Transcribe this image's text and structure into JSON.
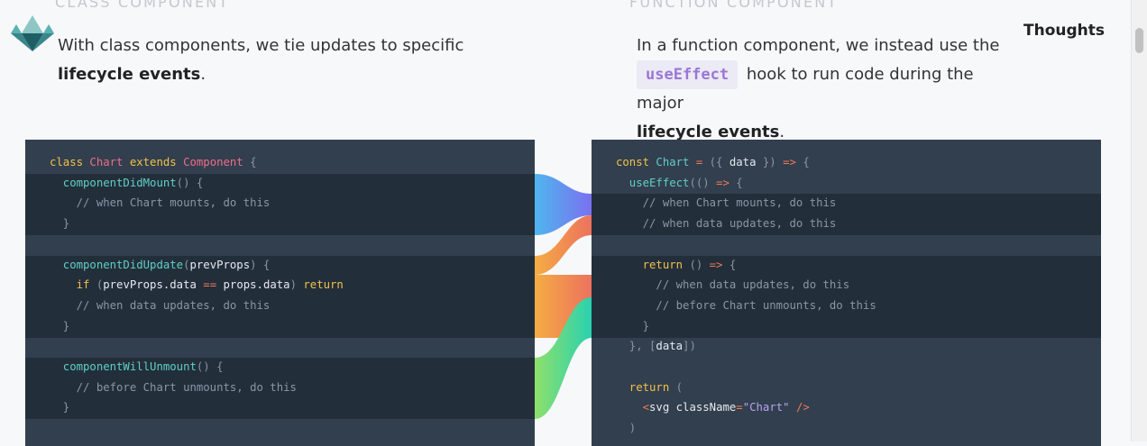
{
  "left": {
    "title": "CLASS COMPONENT",
    "intro": "With class components, we tie updates to specific",
    "bold": "lifecycle events",
    "end": "."
  },
  "right": {
    "title": "FUNCTION COMPONENT",
    "intro": "In a function component, we instead use the",
    "code": "useEffect",
    "middle": "hook to run code during the major",
    "bold": "lifecycle events",
    "end": "."
  },
  "nav": {
    "thoughts": "Thoughts"
  },
  "class_code": [
    [
      [
        "class ",
        "kw"
      ],
      [
        "Chart ",
        "cls"
      ],
      [
        "extends ",
        "kw"
      ],
      [
        "Component ",
        "cls"
      ],
      [
        "{",
        "cm"
      ]
    ],
    [
      [
        "  componentDidMount",
        "fn"
      ],
      [
        "() {",
        "cm"
      ]
    ],
    [
      [
        "    // when Chart mounts, do this",
        "cm"
      ]
    ],
    [
      [
        "  }",
        "cm"
      ]
    ],
    [],
    [
      [
        "  componentDidUpdate",
        "fn"
      ],
      [
        "(",
        "cm"
      ],
      [
        "prevProps",
        "var"
      ],
      [
        ") {",
        "cm"
      ]
    ],
    [
      [
        "    if ",
        "kw"
      ],
      [
        "(",
        "cm"
      ],
      [
        "prevProps",
        "var"
      ],
      [
        ".data ",
        "var"
      ],
      [
        "== ",
        "op"
      ],
      [
        "props",
        "var"
      ],
      [
        ".data",
        "var"
      ],
      [
        ") ",
        "cm"
      ],
      [
        "return",
        "kw"
      ]
    ],
    [
      [
        "    // when data updates, do this",
        "cm"
      ]
    ],
    [
      [
        "  }",
        "cm"
      ]
    ],
    [],
    [
      [
        "  componentWillUnmount",
        "fn"
      ],
      [
        "() {",
        "cm"
      ]
    ],
    [
      [
        "    // before Chart unmounts, do this",
        "cm"
      ]
    ],
    [
      [
        "  }",
        "cm"
      ]
    ]
  ],
  "func_code": [
    [
      [
        "const ",
        "kw"
      ],
      [
        "Chart ",
        "fn"
      ],
      [
        "= ",
        "op"
      ],
      [
        "({ ",
        "cm"
      ],
      [
        "data ",
        "var"
      ],
      [
        "}) ",
        "cm"
      ],
      [
        "=> ",
        "op"
      ],
      [
        "{",
        "cm"
      ]
    ],
    [
      [
        "  useEffect",
        "fn"
      ],
      [
        "(() ",
        "cm"
      ],
      [
        "=> ",
        "op"
      ],
      [
        "{",
        "cm"
      ]
    ],
    [
      [
        "    // when Chart mounts, do this",
        "cm"
      ]
    ],
    [
      [
        "    // when data updates, do this",
        "cm"
      ]
    ],
    [],
    [
      [
        "    return ",
        "kw"
      ],
      [
        "() ",
        "cm"
      ],
      [
        "=> ",
        "op"
      ],
      [
        "{",
        "cm"
      ]
    ],
    [
      [
        "      // when data updates, do this",
        "cm"
      ]
    ],
    [
      [
        "      // before Chart unmounts, do this",
        "cm"
      ]
    ],
    [
      [
        "    }",
        "cm"
      ]
    ],
    [
      [
        "  }, [",
        "cm"
      ],
      [
        "data",
        "var"
      ],
      [
        "])",
        "cm"
      ]
    ],
    [],
    [
      [
        "  return ",
        "kw"
      ],
      [
        "(",
        "cm"
      ]
    ],
    [
      [
        "    <",
        "op"
      ],
      [
        "svg ",
        "var"
      ],
      [
        "className",
        "var"
      ],
      [
        "=",
        "op"
      ],
      [
        "\"Chart\" ",
        "str"
      ],
      [
        "/>",
        "op"
      ]
    ],
    [
      [
        "  )",
        "cm"
      ]
    ]
  ],
  "colors": {
    "mount_flow": "#5aa9f0",
    "update_flow": "#f0a040",
    "unmount_flow": "#4fd3a0",
    "code_bg": "#323f4e",
    "code_band": "#232e3b"
  }
}
